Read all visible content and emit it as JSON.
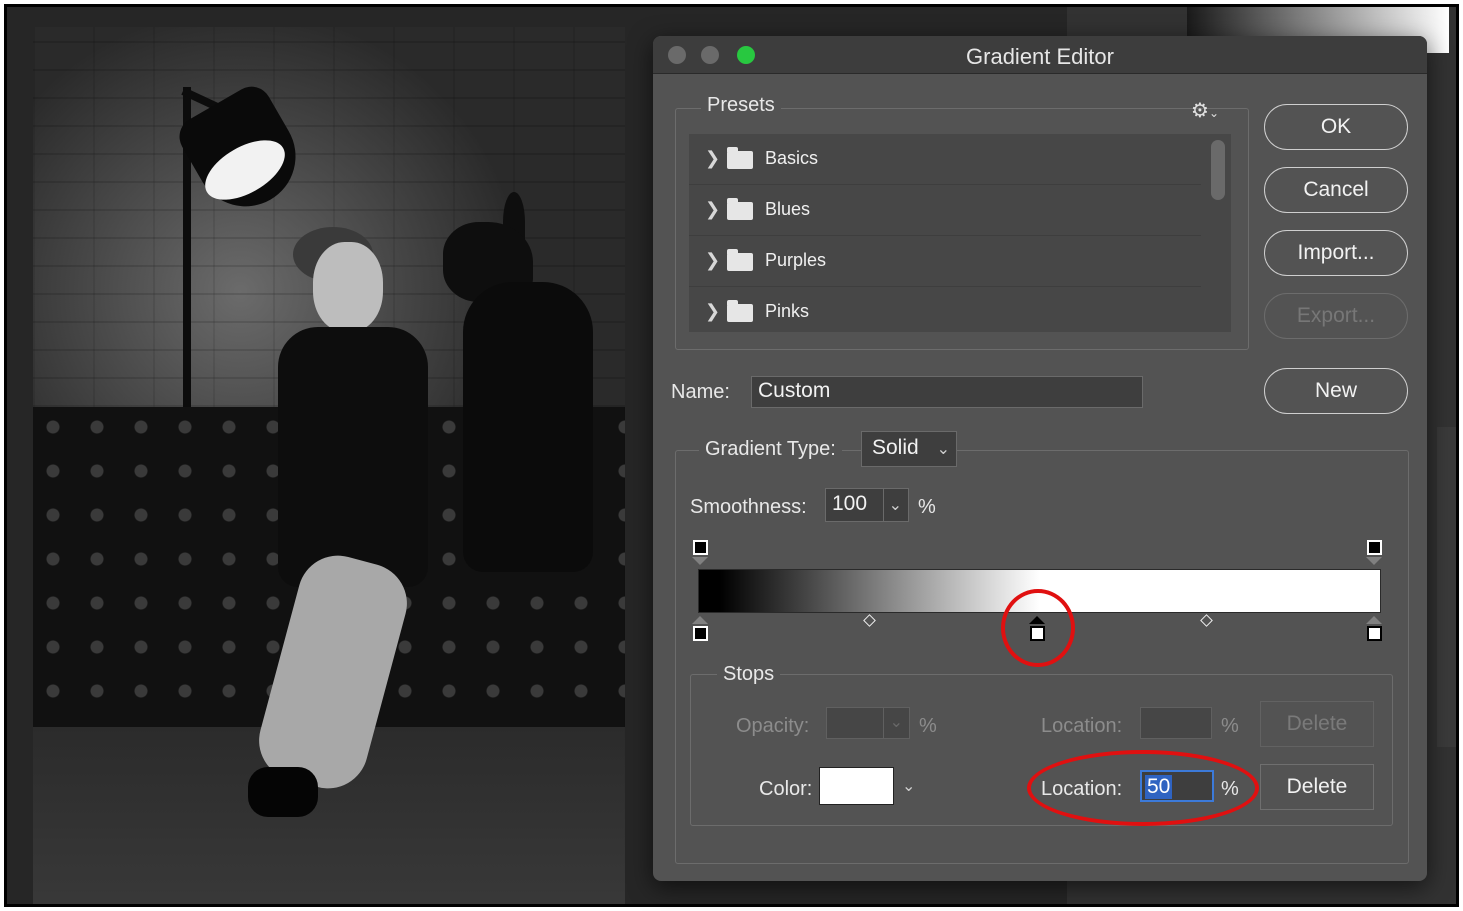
{
  "dialog": {
    "title": "Gradient Editor",
    "presets": {
      "legend": "Presets",
      "gear_icon": "gear-icon",
      "items": [
        {
          "label": "Basics",
          "icon": "folder-icon"
        },
        {
          "label": "Blues",
          "icon": "folder-icon"
        },
        {
          "label": "Purples",
          "icon": "folder-icon"
        },
        {
          "label": "Pinks",
          "icon": "folder-icon"
        }
      ]
    },
    "buttons": {
      "ok": "OK",
      "cancel": "Cancel",
      "import": "Import...",
      "export": "Export...",
      "new": "New"
    },
    "name": {
      "label": "Name:",
      "value": "Custom"
    },
    "gradient_type": {
      "label": "Gradient Type:",
      "value": "Solid"
    },
    "smoothness": {
      "label": "Smoothness:",
      "value": "100",
      "unit": "%"
    },
    "gradient": {
      "stops": [
        {
          "type": "opacity",
          "color": "#000000"
        },
        {
          "type": "opacity",
          "color": "#000000"
        },
        {
          "type": "color",
          "color": "#000000"
        },
        {
          "type": "color",
          "color": "#ffffff",
          "selected": true
        },
        {
          "type": "color",
          "color": "#ffffff"
        }
      ],
      "colors": [
        "#000000",
        "#ffffff"
      ]
    },
    "stops": {
      "legend": "Stops",
      "opacity_label": "Opacity:",
      "opacity_unit": "%",
      "opacity_location_label": "Location:",
      "opacity_location_unit": "%",
      "opacity_delete": "Delete",
      "color_label": "Color:",
      "color_value": "#ffffff",
      "color_location_label": "Location:",
      "color_location_value": "50",
      "color_location_unit": "%",
      "color_delete": "Delete"
    },
    "annotation_color": "#e01010",
    "accent_color": "#28c840"
  }
}
